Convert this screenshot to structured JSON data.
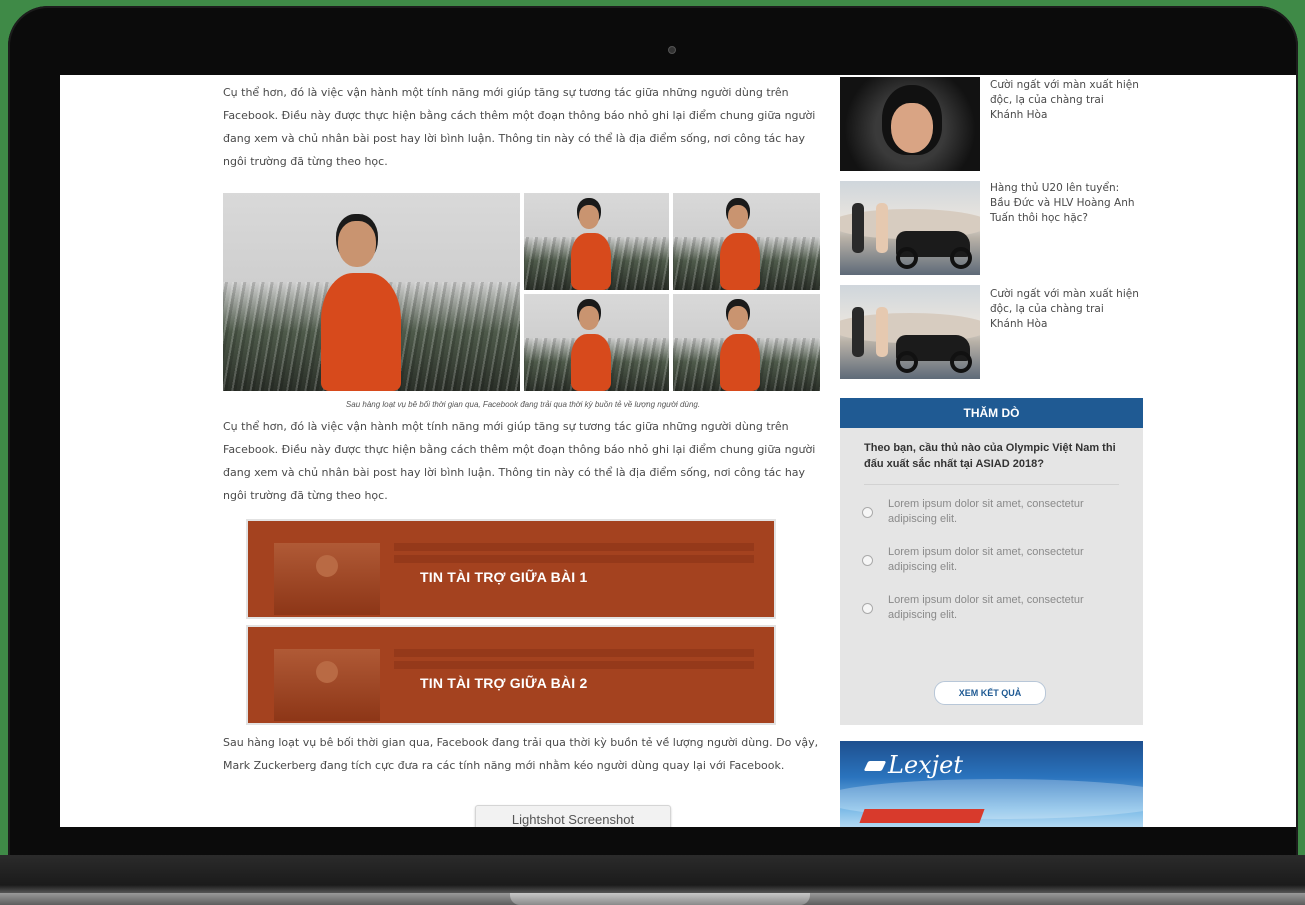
{
  "article": {
    "paragraph_1": "Cụ thể hơn, đó là việc vận hành một tính năng mới giúp tăng sự tương tác giữa những người dùng trên Facebook. Điều này được thực hiện bằng cách thêm một đoạn thông báo nhỏ ghi lại điểm chung giữa người đang xem và chủ nhân bài post hay lời bình luận. Thông tin này có thể là địa điểm sống, nơi công tác hay ngôi trường đã từng theo học.",
    "caption": "Sau hàng loạt vụ bê bối thời gian qua, Facebook đang trải qua thời kỳ buồn tẻ về lượng người dùng.",
    "paragraph_2": "Cụ thể hơn, đó là việc vận hành một tính năng mới giúp tăng sự tương tác giữa những người dùng trên Facebook. Điều này được thực hiện bằng cách thêm một đoạn thông báo nhỏ ghi lại điểm chung giữa người đang xem và chủ nhân bài post hay lời bình luận. Thông tin này có thể là địa điểm sống, nơi công tác hay ngôi trường đã từng theo học.",
    "sponsor_1": "TIN TÀI TRỢ GIỮA BÀI 1",
    "sponsor_2": "TIN TÀI TRỢ GIỮA BÀI 2",
    "paragraph_3": "Sau hàng loạt vụ bê bối thời gian qua, Facebook đang trải qua thời kỳ buồn tẻ về lượng người dùng. Do vậy, Mark Zuckerberg đang tích cực đưa ra các tính năng mới nhằm kéo người dùng quay lại với Facebook."
  },
  "sidebar": {
    "news": [
      {
        "title": "Cười ngất với màn xuất hiện độc, lạ của chàng trai Khánh Hòa"
      },
      {
        "title": "Hàng thủ U20 lên tuyển: Bầu Đức và HLV Hoàng Anh Tuấn thôi học hặc?"
      },
      {
        "title": "Cười ngất với màn xuất hiện độc, lạ của chàng trai Khánh Hòa"
      }
    ],
    "poll": {
      "header": "THĂM DÒ",
      "question": "Theo bạn, cầu thủ nào của Olympic Việt Nam thi đấu xuất sắc nhất tại ASIAD 2018?",
      "options": [
        "Lorem ipsum dolor sit amet, consectetur adipiscing elit.",
        "Lorem ipsum dolor sit amet, consectetur adipiscing elit.",
        "Lorem ipsum dolor sit amet, consectetur adipiscing elit."
      ],
      "result_button": "XEM KẾT QUẢ"
    },
    "ad": {
      "logo": "Lexjet"
    }
  },
  "overlay": {
    "lightshot": "Lightshot Screenshot"
  },
  "colors": {
    "background": "#3f8a47",
    "poll_header": "#1f5a93",
    "sponsor": "#a4421f",
    "text": "#4a4a4a"
  }
}
